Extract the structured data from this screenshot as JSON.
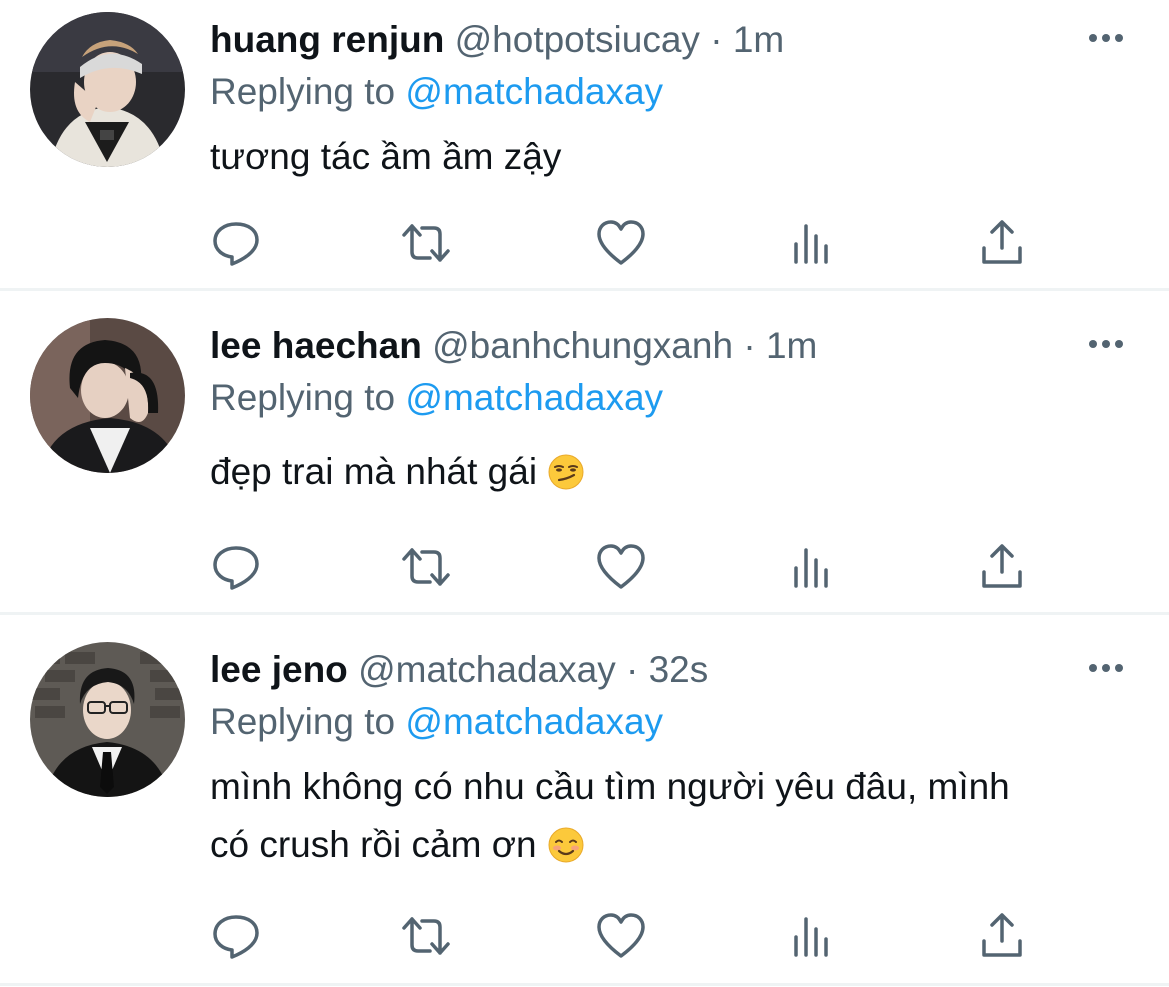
{
  "tweets": [
    {
      "name": "huang renjun",
      "handle": "@hotpotsiucay",
      "separator": "·",
      "time": "1m",
      "replying_prefix": "Replying to",
      "replying_to": "@matchadaxay",
      "lines": [
        "tương tác ầm ầm zậy"
      ],
      "emoji": ""
    },
    {
      "name": "lee haechan",
      "handle": "@banhchungxanh",
      "separator": "·",
      "time": "1m",
      "replying_prefix": "Replying to",
      "replying_to": "@matchadaxay",
      "lines": [
        "đẹp trai mà nhát gái"
      ],
      "emoji": "smirking-face"
    },
    {
      "name": "lee jeno",
      "handle": "@matchadaxay",
      "separator": "·",
      "time": "32s",
      "replying_prefix": "Replying to",
      "replying_to": "@matchadaxay",
      "lines": [
        "mình không có nhu cầu tìm người yêu đâu, mình",
        "có crush rồi cảm ơn"
      ],
      "emoji": "smiling-face"
    }
  ],
  "actions": [
    "reply-icon",
    "retweet-icon",
    "like-icon",
    "views-icon",
    "share-icon"
  ],
  "colors": {
    "text": "#0f1419",
    "secondary": "#536471",
    "mention": "#1d9bf0",
    "divider": "#eff3f4"
  }
}
